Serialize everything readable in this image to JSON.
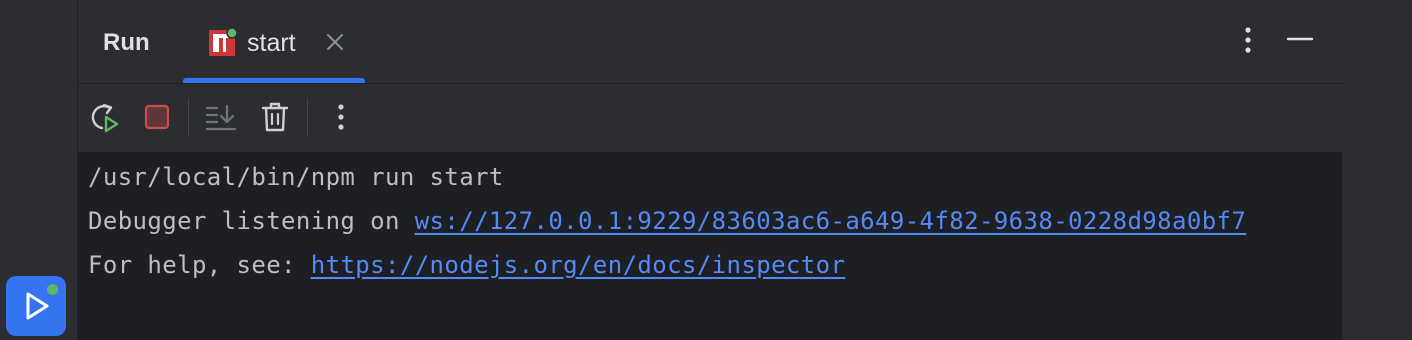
{
  "tool_window": {
    "title": "Run",
    "tabs": [
      {
        "label": "start",
        "active": true,
        "icon": "npm-icon",
        "status": "running"
      }
    ]
  },
  "header_actions": {
    "more_icon": "vertical-ellipsis-icon",
    "minimize_icon": "minimize-icon"
  },
  "toolbar": {
    "buttons": [
      "rerun-icon",
      "stop-icon",
      "scroll-to-end-icon",
      "clear-all-icon",
      "more-icon"
    ]
  },
  "console": {
    "line1": "/usr/local/bin/npm run start",
    "line2_prefix": "Debugger listening on ",
    "line2_link": "ws://127.0.0.1:9229/83603ac6-a649-4f82-9638-0228d98a0bf7",
    "line3_prefix": "For help, see: ",
    "line3_link": "https://nodejs.org/en/docs/inspector"
  },
  "colors": {
    "accent": "#3574f0",
    "link": "#548af7",
    "running_dot": "#5fb865",
    "stop": "#c94f4f",
    "npm_red": "#cb3837"
  }
}
